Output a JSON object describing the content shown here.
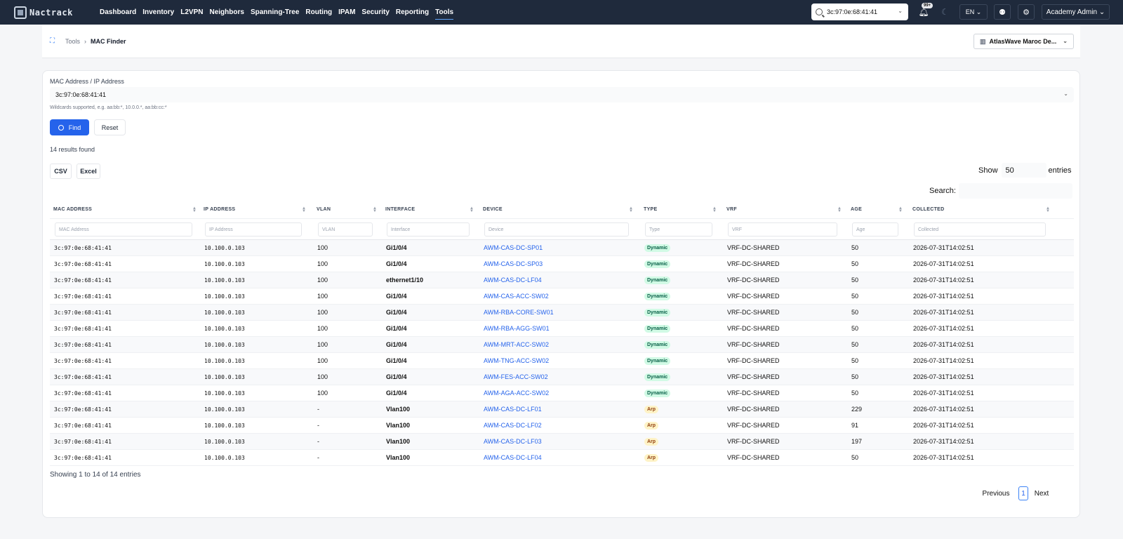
{
  "brand": {
    "name": "Nactrack"
  },
  "nav": [
    "Dashboard",
    "Inventory",
    "L2VPN",
    "Neighbors",
    "Spanning-Tree",
    "Routing",
    "IPAM",
    "Security",
    "Reporting",
    "Tools"
  ],
  "topbar": {
    "search_value": "3c:97:0e:68:41:41",
    "notifications_badge": "99+",
    "language": "EN",
    "user": "Academy Admin"
  },
  "breadcrumb": {
    "parent": "Tools",
    "current": "MAC Finder"
  },
  "tenant": {
    "selected": "AtlasWave Maroc De..."
  },
  "form": {
    "label": "MAC Address / IP Address",
    "value": "3c:97:0e:68:41:41",
    "hint": "Wildcards supported, e.g. aa:bb:*, 10.0.0.*, aa:bb:cc:*",
    "find_label": "Find",
    "reset_label": "Reset"
  },
  "results_text": "14 results found",
  "export": {
    "csv": "CSV",
    "excel": "Excel"
  },
  "show": {
    "prefix": "Show",
    "value": "50",
    "suffix": "entries"
  },
  "search_label": "Search:",
  "table": {
    "columns": [
      "MAC ADDRESS",
      "IP ADDRESS",
      "VLAN",
      "INTERFACE",
      "DEVICE",
      "TYPE",
      "VRF",
      "AGE",
      "COLLECTED"
    ],
    "filters": [
      "MAC Address",
      "IP Address",
      "VLAN",
      "Interface",
      "Device",
      "Type",
      "VRF",
      "Age",
      "Collected"
    ],
    "rows": [
      {
        "mac": "3c:97:0e:68:41:41",
        "ip": "10.100.0.103",
        "vlan": "100",
        "iface": "Gi1/0/4",
        "device": "AWM-CAS-DC-SP01",
        "type": "Dynamic",
        "vrf": "VRF-DC-SHARED",
        "age": "50",
        "collected": "2026-07-31T14:02:51"
      },
      {
        "mac": "3c:97:0e:68:41:41",
        "ip": "10.100.0.103",
        "vlan": "100",
        "iface": "Gi1/0/4",
        "device": "AWM-CAS-DC-SP03",
        "type": "Dynamic",
        "vrf": "VRF-DC-SHARED",
        "age": "50",
        "collected": "2026-07-31T14:02:51"
      },
      {
        "mac": "3c:97:0e:68:41:41",
        "ip": "10.100.0.103",
        "vlan": "100",
        "iface": "ethernet1/10",
        "device": "AWM-CAS-DC-LF04",
        "type": "Dynamic",
        "vrf": "VRF-DC-SHARED",
        "age": "50",
        "collected": "2026-07-31T14:02:51"
      },
      {
        "mac": "3c:97:0e:68:41:41",
        "ip": "10.100.0.103",
        "vlan": "100",
        "iface": "Gi1/0/4",
        "device": "AWM-CAS-ACC-SW02",
        "type": "Dynamic",
        "vrf": "VRF-DC-SHARED",
        "age": "50",
        "collected": "2026-07-31T14:02:51"
      },
      {
        "mac": "3c:97:0e:68:41:41",
        "ip": "10.100.0.103",
        "vlan": "100",
        "iface": "Gi1/0/4",
        "device": "AWM-RBA-CORE-SW01",
        "type": "Dynamic",
        "vrf": "VRF-DC-SHARED",
        "age": "50",
        "collected": "2026-07-31T14:02:51"
      },
      {
        "mac": "3c:97:0e:68:41:41",
        "ip": "10.100.0.103",
        "vlan": "100",
        "iface": "Gi1/0/4",
        "device": "AWM-RBA-AGG-SW01",
        "type": "Dynamic",
        "vrf": "VRF-DC-SHARED",
        "age": "50",
        "collected": "2026-07-31T14:02:51"
      },
      {
        "mac": "3c:97:0e:68:41:41",
        "ip": "10.100.0.103",
        "vlan": "100",
        "iface": "Gi1/0/4",
        "device": "AWM-MRT-ACC-SW02",
        "type": "Dynamic",
        "vrf": "VRF-DC-SHARED",
        "age": "50",
        "collected": "2026-07-31T14:02:51"
      },
      {
        "mac": "3c:97:0e:68:41:41",
        "ip": "10.100.0.103",
        "vlan": "100",
        "iface": "Gi1/0/4",
        "device": "AWM-TNG-ACC-SW02",
        "type": "Dynamic",
        "vrf": "VRF-DC-SHARED",
        "age": "50",
        "collected": "2026-07-31T14:02:51"
      },
      {
        "mac": "3c:97:0e:68:41:41",
        "ip": "10.100.0.103",
        "vlan": "100",
        "iface": "Gi1/0/4",
        "device": "AWM-FES-ACC-SW02",
        "type": "Dynamic",
        "vrf": "VRF-DC-SHARED",
        "age": "50",
        "collected": "2026-07-31T14:02:51"
      },
      {
        "mac": "3c:97:0e:68:41:41",
        "ip": "10.100.0.103",
        "vlan": "100",
        "iface": "Gi1/0/4",
        "device": "AWM-AGA-ACC-SW02",
        "type": "Dynamic",
        "vrf": "VRF-DC-SHARED",
        "age": "50",
        "collected": "2026-07-31T14:02:51"
      },
      {
        "mac": "3c:97:0e:68:41:41",
        "ip": "10.100.0.103",
        "vlan": "-",
        "iface": "Vlan100",
        "device": "AWM-CAS-DC-LF01",
        "type": "Arp",
        "vrf": "VRF-DC-SHARED",
        "age": "229",
        "collected": "2026-07-31T14:02:51"
      },
      {
        "mac": "3c:97:0e:68:41:41",
        "ip": "10.100.0.103",
        "vlan": "-",
        "iface": "Vlan100",
        "device": "AWM-CAS-DC-LF02",
        "type": "Arp",
        "vrf": "VRF-DC-SHARED",
        "age": "91",
        "collected": "2026-07-31T14:02:51"
      },
      {
        "mac": "3c:97:0e:68:41:41",
        "ip": "10.100.0.103",
        "vlan": "-",
        "iface": "Vlan100",
        "device": "AWM-CAS-DC-LF03",
        "type": "Arp",
        "vrf": "VRF-DC-SHARED",
        "age": "197",
        "collected": "2026-07-31T14:02:51"
      },
      {
        "mac": "3c:97:0e:68:41:41",
        "ip": "10.100.0.103",
        "vlan": "-",
        "iface": "Vlan100",
        "device": "AWM-CAS-DC-LF04",
        "type": "Arp",
        "vrf": "VRF-DC-SHARED",
        "age": "50",
        "collected": "2026-07-31T14:02:51"
      }
    ]
  },
  "footer": {
    "showing": "Showing 1 to 14 of 14 entries",
    "previous": "Previous",
    "page": "1",
    "next": "Next"
  },
  "colors": {
    "nav_bg": "#1f2a3c",
    "primary": "#2563eb",
    "dynamic_bg": "#d1fae5",
    "arp_bg": "#fef3c7"
  },
  "icons": [
    "logo-icon",
    "search-icon",
    "bell-icon",
    "moon-icon",
    "robot-icon",
    "gear-icon",
    "network-icon",
    "building-icon",
    "chevron-down-icon",
    "sort-icon"
  ]
}
